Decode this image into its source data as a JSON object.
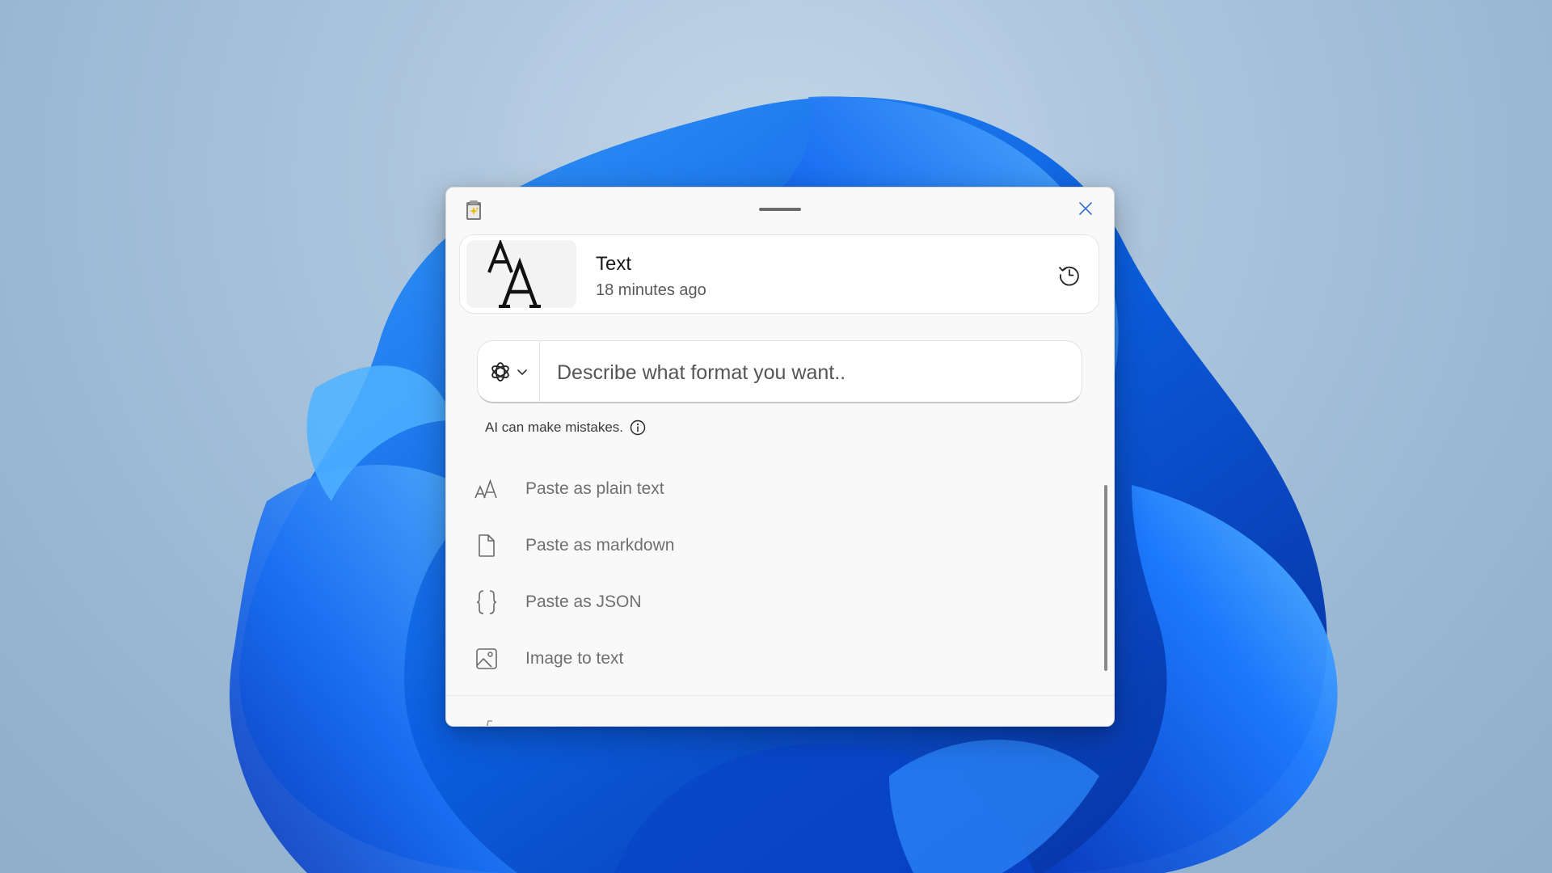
{
  "window": {
    "clip": {
      "title": "Text",
      "time": "18 minutes ago",
      "thumbnail_glyph": "AA"
    },
    "prompt": {
      "placeholder": "Describe what format you want..",
      "value": "",
      "model_icon": "openai-icon"
    },
    "disclaimer": {
      "text": "AI can make mistakes."
    },
    "actions": [
      {
        "label": "Paste as plain text",
        "icon": "font-size-icon"
      },
      {
        "label": "Paste as markdown",
        "icon": "document-icon"
      },
      {
        "label": "Paste as JSON",
        "icon": "braces-icon"
      },
      {
        "label": "Image to text",
        "icon": "image-icon"
      }
    ]
  },
  "colors": {
    "accent": "#0067c0",
    "window_bg": "#f9f9f9",
    "close_icon": "#2f6fd6",
    "app_icon": "#f1b600"
  }
}
